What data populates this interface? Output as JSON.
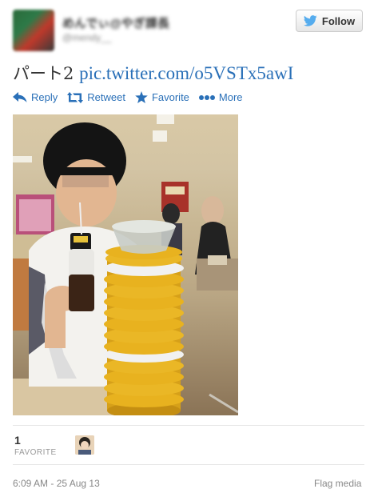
{
  "header": {
    "display_name": "めんでぃ@やぎ課長",
    "screen_name": "@mendy__",
    "follow_label": "Follow"
  },
  "tweet": {
    "text": "パート2",
    "link": "pic.twitter.com/o5VSTx5awI"
  },
  "actions": {
    "reply": "Reply",
    "retweet": "Retweet",
    "favorite": "Favorite",
    "more": "More"
  },
  "stats": {
    "favorite_count": "1",
    "favorite_label": "FAVORITE"
  },
  "footer": {
    "timestamp": "6:09 AM - 25 Aug 13",
    "flag_media": "Flag media"
  },
  "colors": {
    "link": "#2a70b8",
    "twitter_bird": "#55acee",
    "plate_yellow": "#e8b21f"
  },
  "icons": [
    "twitter-bird-icon",
    "reply-icon",
    "retweet-icon",
    "star-icon",
    "more-dots-icon"
  ]
}
